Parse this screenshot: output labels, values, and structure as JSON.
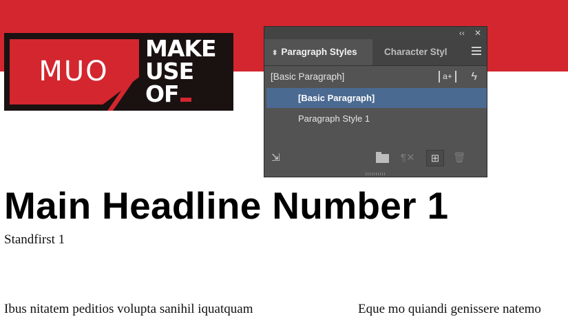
{
  "logo": {
    "short": "MUO",
    "words": [
      "MAKE",
      "USE",
      "OF"
    ]
  },
  "panel": {
    "collapse_glyph": "‹‹",
    "close_glyph": "✕",
    "tabs": [
      {
        "label": "Paragraph Styles",
        "active": true
      },
      {
        "label": "Character Styl",
        "active": false
      }
    ],
    "current_style": "[Basic Paragraph]",
    "override_icon_label": "a+",
    "styles": [
      {
        "label": "[Basic Paragraph]",
        "selected": true
      },
      {
        "label": "Paragraph Style 1",
        "selected": false
      }
    ],
    "icons": [
      "load-styles-icon",
      "folder-icon",
      "clear-overrides-icon",
      "new-style-icon",
      "trash-icon",
      "panel-menu-icon",
      "lightning-icon"
    ]
  },
  "document": {
    "headline": "Main Headline Number 1",
    "standfirst": "Standfirst 1",
    "body_col1": "Ibus nitatem peditios volupta sanihil iquatquam",
    "body_col2": "Eque mo quiandi genissere natemo"
  },
  "colors": {
    "brand_red": "#d3262f",
    "logo_dark": "#1a1111",
    "panel_bg": "#535353",
    "selection": "#4b6a92"
  }
}
